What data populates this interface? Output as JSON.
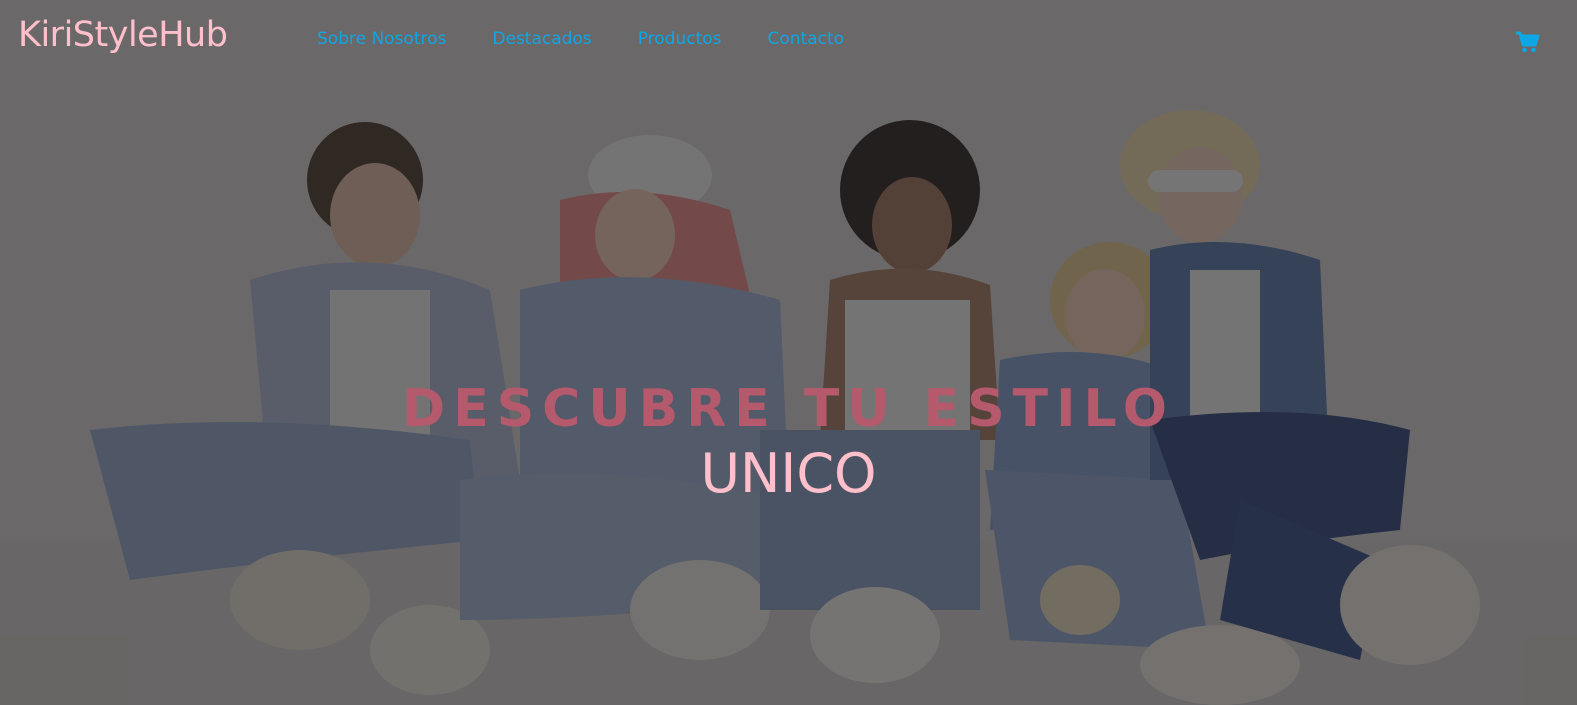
{
  "brand": "KiriStyleHub",
  "nav": {
    "items": [
      "Sobre Nosotros",
      "Destacados",
      "Productos",
      "Contacto"
    ]
  },
  "cart": {
    "icon": "cart-icon"
  },
  "hero": {
    "headline": "DESCUBRE TU ESTILO",
    "subheadline": "UNICO"
  },
  "colors": {
    "brand": "#ffc0cb",
    "nav_link": "#0ea7e6",
    "headline": "#b55a6c",
    "subheadline": "#ffc0cb",
    "overlay": "#282626"
  }
}
